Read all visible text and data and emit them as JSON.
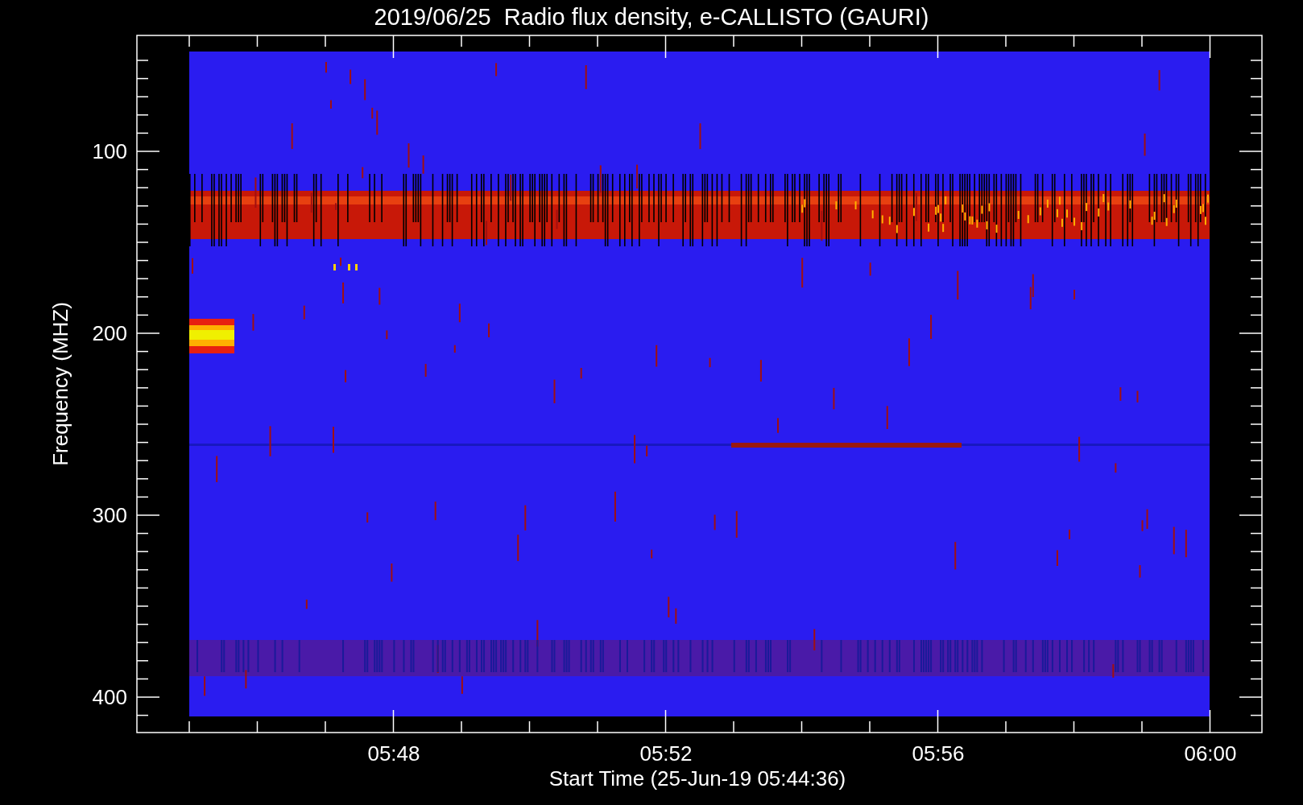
{
  "plot": {
    "title": "2019/06/25  Radio flux density, e-CALLISTO (GAURI)",
    "xlabel": "Start Time (25-Jun-19 05:44:36)",
    "ylabel": "Frequency (MHZ)",
    "xtick_labels": [
      "05:48",
      "05:52",
      "05:56",
      "06:00"
    ],
    "ytick_labels": [
      "100",
      "200",
      "300",
      "400"
    ]
  }
}
